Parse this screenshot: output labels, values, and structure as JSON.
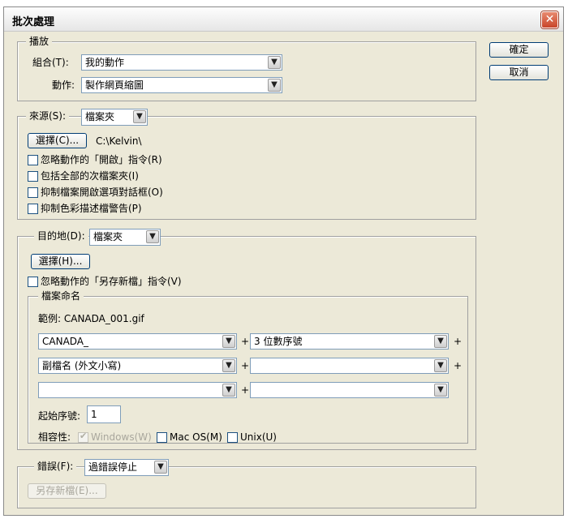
{
  "window": {
    "title": "批次處理"
  },
  "buttons": {
    "ok": "確定",
    "cancel": "取消"
  },
  "play": {
    "legend": "播放",
    "set_label": "組合(T):",
    "set_value": "我的動作",
    "action_label": "動作:",
    "action_value": "製作網頁縮圖"
  },
  "source": {
    "label": "來源(S):",
    "value": "檔案夾",
    "choose_button": "選擇(C)...",
    "path": "C:\\Kelvin\\",
    "checks": [
      {
        "label": "忽略動作的「開啟」指令(R)",
        "checked": false
      },
      {
        "label": "包括全部的次檔案夾(I)",
        "checked": false
      },
      {
        "label": "抑制檔案開啟選項對話框(O)",
        "checked": false
      },
      {
        "label": "抑制色彩描述檔警告(P)",
        "checked": false
      }
    ]
  },
  "destination": {
    "label": "目的地(D):",
    "value": "檔案夾",
    "choose_button": "選擇(H)...",
    "override_save": "忽略動作的「另存新檔」指令(V)",
    "naming": {
      "legend": "檔案命名",
      "example": "範例: CANADA_001.gif",
      "fields": [
        "CANADA_",
        "3 位數序號",
        "副檔名 (外文小寫)",
        "",
        "",
        ""
      ],
      "start_label": "起始序號:",
      "start_value": "1",
      "compat_label": "相容性:",
      "compat": [
        {
          "label": "Windows(W)",
          "checked": true,
          "disabled": true
        },
        {
          "label": "Mac OS(M)",
          "checked": false,
          "disabled": false
        },
        {
          "label": "Unix(U)",
          "checked": false,
          "disabled": false
        }
      ]
    }
  },
  "errors": {
    "label": "錯誤(F):",
    "value": "過錯誤停止",
    "save_as_button": "另存新檔(E)..."
  },
  "plus": "+"
}
